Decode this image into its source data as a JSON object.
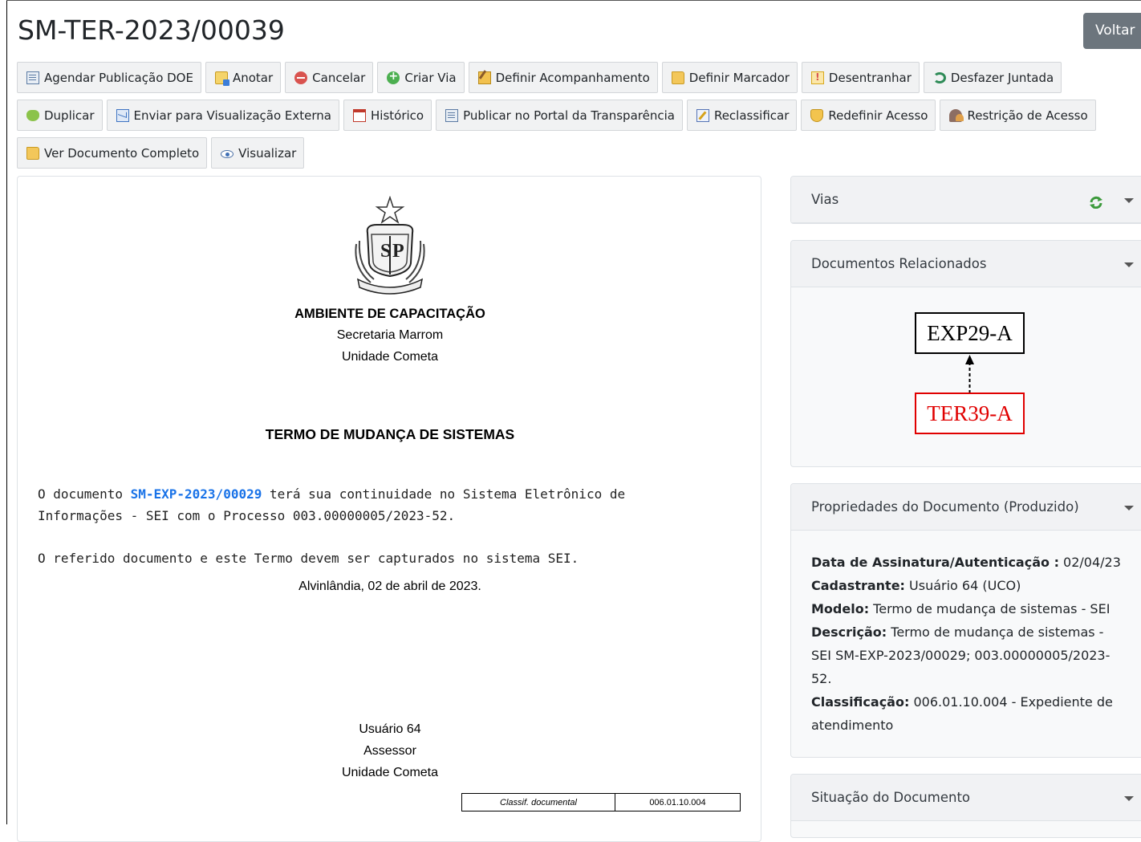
{
  "header": {
    "title": "SM-TER-2023/00039",
    "back_label": "Voltar"
  },
  "toolbar": {
    "rows": [
      [
        {
          "icon": "document-icon",
          "label": "Agendar Publicação DOE"
        },
        {
          "icon": "note-icon",
          "label": "Anotar"
        },
        {
          "icon": "cancel-icon",
          "label": "Cancelar"
        },
        {
          "icon": "plus-icon",
          "label": "Criar Via"
        },
        {
          "icon": "pen-icon",
          "label": "Definir Acompanhamento"
        },
        {
          "icon": "folder-bookmark-icon",
          "label": "Definir Marcador"
        },
        {
          "icon": "warning-icon",
          "label": "Desentranhar"
        },
        {
          "icon": "undo-icon",
          "label": "Desfazer Juntada"
        }
      ],
      [
        {
          "icon": "duplicate-icon",
          "label": "Duplicar"
        },
        {
          "icon": "mail-icon",
          "label": "Enviar para Visualização Externa"
        },
        {
          "icon": "calendar-icon",
          "label": "Histórico"
        },
        {
          "icon": "document-icon",
          "label": "Publicar no Portal da Transparência"
        },
        {
          "icon": "edit-icon",
          "label": "Reclassificar"
        },
        {
          "icon": "shield-icon",
          "label": "Redefinir Acesso"
        },
        {
          "icon": "people-icon",
          "label": "Restrição de Acesso"
        }
      ],
      [
        {
          "icon": "folder-icon",
          "label": "Ver Documento Completo"
        },
        {
          "icon": "eye-icon",
          "label": "Visualizar"
        }
      ]
    ]
  },
  "document": {
    "org": "AMBIENTE DE CAPACITAÇÃO",
    "secretaria": "Secretaria Marrom",
    "unidade": "Unidade Cometa",
    "doc_title": "TERMO DE MUDANÇA DE SISTEMAS",
    "p1_pre": "O documento ",
    "p1_link": "SM-EXP-2023/00029",
    "p1_post": " terá sua continuidade no Sistema Eletrônico de",
    "p1_line2": "Informações - SEI com o Processo 003.00000005/2023-52.",
    "p2": "O referido documento e este Termo devem ser capturados no sistema SEI.",
    "date_line": "Alvinlândia, 02 de abril de 2023.",
    "sig_name": "Usuário 64",
    "sig_role": "Assessor",
    "sig_unit": "Unidade Cometa",
    "classif_label": "Classif. documental",
    "classif_value": "006.01.10.004"
  },
  "sidebar": {
    "vias_title": "Vias",
    "related_title": "Documentos Relacionados",
    "related_parent": "EXP29-A",
    "related_child": "TER39-A",
    "props_title": "Propriedades do Documento (Produzido)",
    "props": {
      "assinatura_label": "Data de Assinatura/Autenticação :",
      "assinatura_value": " 02/04/23",
      "cadastrante_label": "Cadastrante:",
      "cadastrante_value": " Usuário 64 (UCO)",
      "modelo_label": "Modelo:",
      "modelo_value": " Termo de mudança de sistemas - SEI",
      "descricao_label": "Descrição:",
      "descricao_value": " Termo de mudança de sistemas - SEI SM-EXP-2023/00029; 003.00000005/2023-52.",
      "classificacao_label": "Classificação:",
      "classificacao_value": " 006.01.10.004 - Expediente de atendimento"
    },
    "situacao_title": "Situação do Documento"
  }
}
